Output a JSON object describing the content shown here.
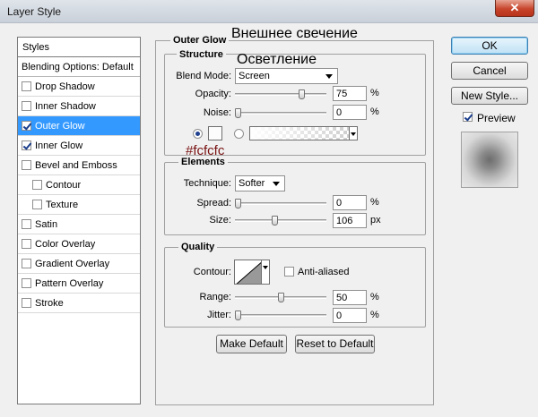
{
  "window": {
    "title": "Layer Style",
    "close_label": "✕"
  },
  "styles_panel": {
    "header": "Styles",
    "blending_options": "Blending Options: Default",
    "items": [
      {
        "label": "Drop Shadow",
        "checked": false,
        "selected": false,
        "indent": false
      },
      {
        "label": "Inner Shadow",
        "checked": false,
        "selected": false,
        "indent": false
      },
      {
        "label": "Outer Glow",
        "checked": true,
        "selected": true,
        "indent": false
      },
      {
        "label": "Inner Glow",
        "checked": true,
        "selected": false,
        "indent": false
      },
      {
        "label": "Bevel and Emboss",
        "checked": false,
        "selected": false,
        "indent": false
      },
      {
        "label": "Contour",
        "checked": false,
        "selected": false,
        "indent": true
      },
      {
        "label": "Texture",
        "checked": false,
        "selected": false,
        "indent": true
      },
      {
        "label": "Satin",
        "checked": false,
        "selected": false,
        "indent": false
      },
      {
        "label": "Color Overlay",
        "checked": false,
        "selected": false,
        "indent": false
      },
      {
        "label": "Gradient Overlay",
        "checked": false,
        "selected": false,
        "indent": false
      },
      {
        "label": "Pattern Overlay",
        "checked": false,
        "selected": false,
        "indent": false
      },
      {
        "label": "Stroke",
        "checked": false,
        "selected": false,
        "indent": false
      }
    ]
  },
  "outer_glow": {
    "title": "Outer Glow",
    "structure": {
      "title": "Structure",
      "blend_mode_label": "Blend Mode:",
      "blend_mode_value": "Screen",
      "opacity_label": "Opacity:",
      "opacity_value": "75",
      "opacity_fraction": 0.75,
      "noise_label": "Noise:",
      "noise_value": "0",
      "noise_fraction": 0,
      "percent": "%",
      "color_hex": "#fcfcfc"
    },
    "elements": {
      "title": "Elements",
      "technique_label": "Technique:",
      "technique_value": "Softer",
      "spread_label": "Spread:",
      "spread_value": "0",
      "spread_fraction": 0,
      "size_label": "Size:",
      "size_value": "106",
      "size_fraction": 0.43,
      "percent": "%",
      "px": "px"
    },
    "quality": {
      "title": "Quality",
      "contour_label": "Contour:",
      "anti_aliased_label": "Anti-aliased",
      "anti_aliased_checked": false,
      "range_label": "Range:",
      "range_value": "50",
      "range_fraction": 0.5,
      "jitter_label": "Jitter:",
      "jitter_value": "0",
      "jitter_fraction": 0,
      "percent": "%"
    },
    "make_default": "Make Default",
    "reset_to_default": "Reset to Default"
  },
  "buttons": {
    "ok": "OK",
    "cancel": "Cancel",
    "new_style": "New Style...",
    "preview": "Preview",
    "preview_checked": true
  },
  "annotations": {
    "outer_glow_ru": "Внешнее свечение",
    "blend_mode_ru": "Осветление",
    "color_hex": "#fcfcfc"
  }
}
